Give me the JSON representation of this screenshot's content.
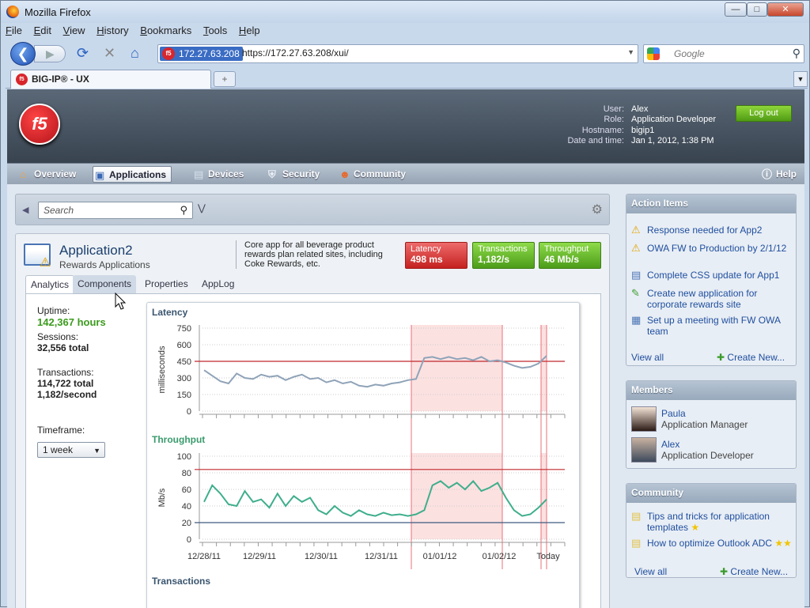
{
  "window": {
    "title": "Mozilla Firefox",
    "min": "—",
    "max": "□",
    "close": "✕"
  },
  "menu": [
    "File",
    "Edit",
    "View",
    "History",
    "Bookmarks",
    "Tools",
    "Help"
  ],
  "nav": {
    "site_badge": "172.27.63.208",
    "url": "https://172.27.63.208/xui/",
    "search_placeholder": "Google"
  },
  "tab": {
    "title": "BIG-IP® - UX",
    "newtab": "+"
  },
  "header": {
    "logo_text": "f5",
    "user_labels": [
      "User:",
      "Role:",
      "Hostname:",
      "Date and time:"
    ],
    "user_values": [
      "Alex",
      "Application Developer",
      "bigip1",
      "Jan 1, 2012, 1:38 PM"
    ],
    "logout": "Log out"
  },
  "mainnav": {
    "items": [
      "Overview",
      "Applications",
      "Devices",
      "Security",
      "Community"
    ],
    "help": "Help"
  },
  "search": {
    "placeholder": "Search"
  },
  "app": {
    "name": "Application2",
    "subtitle": "Rewards Applications",
    "description": "Core app for all beverage product rewards plan related sites, including Coke Rewards, etc.",
    "kpis": [
      {
        "label": "Latency",
        "value": "498 ms",
        "status": "red"
      },
      {
        "label": "Transactions",
        "value": "1,182/s",
        "status": "green"
      },
      {
        "label": "Throughput",
        "value": "46 Mb/s",
        "status": "green"
      }
    ],
    "tabs": [
      "Analytics",
      "Components",
      "Properties",
      "AppLog"
    ]
  },
  "stats": {
    "uptime_label": "Uptime:",
    "uptime_value": "142,367 hours",
    "sessions_label": "Sessions:",
    "sessions_value": "32,556 total",
    "transactions_label": "Transactions:",
    "transactions_total": "114,722 total",
    "transactions_rate": "1,182/second",
    "timeframe_label": "Timeframe:",
    "timeframe_value": "1 week"
  },
  "chart_data": [
    {
      "type": "line",
      "title": "Latency",
      "ylabel": "milliseconds",
      "ylim": [
        0,
        750
      ],
      "yticks": [
        0,
        150,
        300,
        450,
        600,
        750
      ],
      "threshold": 450,
      "x_labels": [
        "12/28/11",
        "12/29/11",
        "12/30/11",
        "12/31/11",
        "01/01/12",
        "01/02/12",
        "Today"
      ],
      "series": [
        {
          "values": [
            370,
            320,
            270,
            250,
            340,
            300,
            290,
            330,
            310,
            320,
            280,
            310,
            330,
            290,
            300,
            260,
            280,
            250,
            265,
            230,
            220,
            240,
            230,
            250,
            260,
            280,
            290,
            480,
            490,
            470,
            490,
            470,
            480,
            460,
            490,
            450,
            460,
            440,
            410,
            390,
            400,
            430,
            500
          ]
        }
      ]
    },
    {
      "type": "line",
      "title": "Throughput",
      "ylabel": "Mb/s",
      "ylim": [
        0,
        100
      ],
      "yticks": [
        0,
        20,
        40,
        60,
        80,
        100
      ],
      "threshold_high": 84,
      "threshold_low": 20,
      "x_labels": [
        "12/28/11",
        "12/29/11",
        "12/30/11",
        "12/31/11",
        "01/01/12",
        "01/02/12",
        "Today"
      ],
      "series": [
        {
          "values": [
            45,
            65,
            55,
            42,
            40,
            58,
            45,
            48,
            38,
            55,
            40,
            52,
            45,
            50,
            35,
            30,
            40,
            32,
            28,
            35,
            30,
            28,
            32,
            29,
            30,
            28,
            30,
            35,
            65,
            70,
            62,
            68,
            60,
            70,
            58,
            62,
            68,
            50,
            35,
            28,
            30,
            38,
            48
          ]
        }
      ]
    }
  ],
  "chart_labels": {
    "transactions": "Transactions"
  },
  "action_items": {
    "title": "Action Items",
    "items": [
      {
        "icon": "warning",
        "text": "Response needed for App2"
      },
      {
        "icon": "warning",
        "text": "OWA FW to Production by 2/1/12"
      },
      {
        "icon": "task",
        "text": "Complete CSS update for App1"
      },
      {
        "icon": "edit",
        "text": "Create new application for corporate rewards site"
      },
      {
        "icon": "calendar",
        "text": "Set up a meeting with FW OWA team"
      }
    ],
    "view_all": "View all",
    "create_new": "Create New..."
  },
  "members": {
    "title": "Members",
    "items": [
      {
        "name": "Paula",
        "role": "Application Manager"
      },
      {
        "name": "Alex",
        "role": "Application Developer"
      }
    ]
  },
  "community": {
    "title": "Community",
    "items": [
      {
        "text": "Tips and tricks for application templates"
      },
      {
        "text": "How to optimize Outlook ADC"
      }
    ],
    "view_all": "View all",
    "create_new": "Create New..."
  }
}
